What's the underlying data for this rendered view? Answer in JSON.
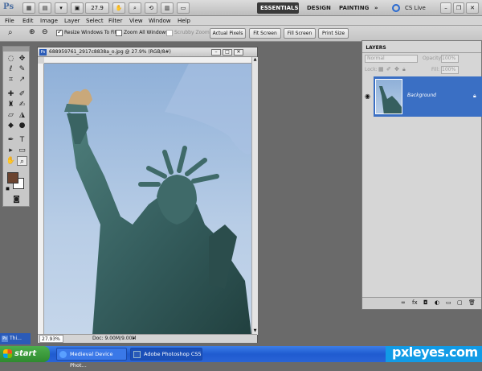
{
  "appbar": {
    "logo": "Ps",
    "zoom": "27.9",
    "workspaces": [
      "ESSENTIALS",
      "DESIGN",
      "PAINTING"
    ],
    "more": "»",
    "cs_live": "CS Live"
  },
  "menu": [
    "File",
    "Edit",
    "Image",
    "Layer",
    "Select",
    "Filter",
    "View",
    "Window",
    "Help"
  ],
  "options": {
    "resize_windows": "Resize Windows To Fit",
    "zoom_all": "Zoom All Windows",
    "scrubby": "Scrubby Zoom",
    "actual_pixels": "Actual Pixels",
    "fit_screen": "Fit Screen",
    "fill_screen": "Fill Screen",
    "print_size": "Print Size"
  },
  "document": {
    "title": "688959761_2917c8838a_o.jpg @ 27.9% (RGB/8#)",
    "zoom_status": "27.93%",
    "doc_size": "Doc: 9.00M/9.00M"
  },
  "layers": {
    "tab": "LAYERS",
    "blend_mode": "Normal",
    "opacity_label": "Opacity:",
    "opacity_value": "100%",
    "lock_label": "Lock:",
    "fill_label": "Fill:",
    "fill_value": "100%",
    "layer_name": "Background"
  },
  "taskbar": {
    "start": "start",
    "tasks": [
      "Medieval Device Phot...",
      "Adobe Photoshop CS5"
    ],
    "minimized_doc": "Thi..."
  },
  "watermark": "pxleyes.com",
  "colors": {
    "foreground": "#6b4430",
    "background": "#ffffff",
    "layer_selected": "#3a6fc4",
    "taskbar": "#2a64d6"
  }
}
